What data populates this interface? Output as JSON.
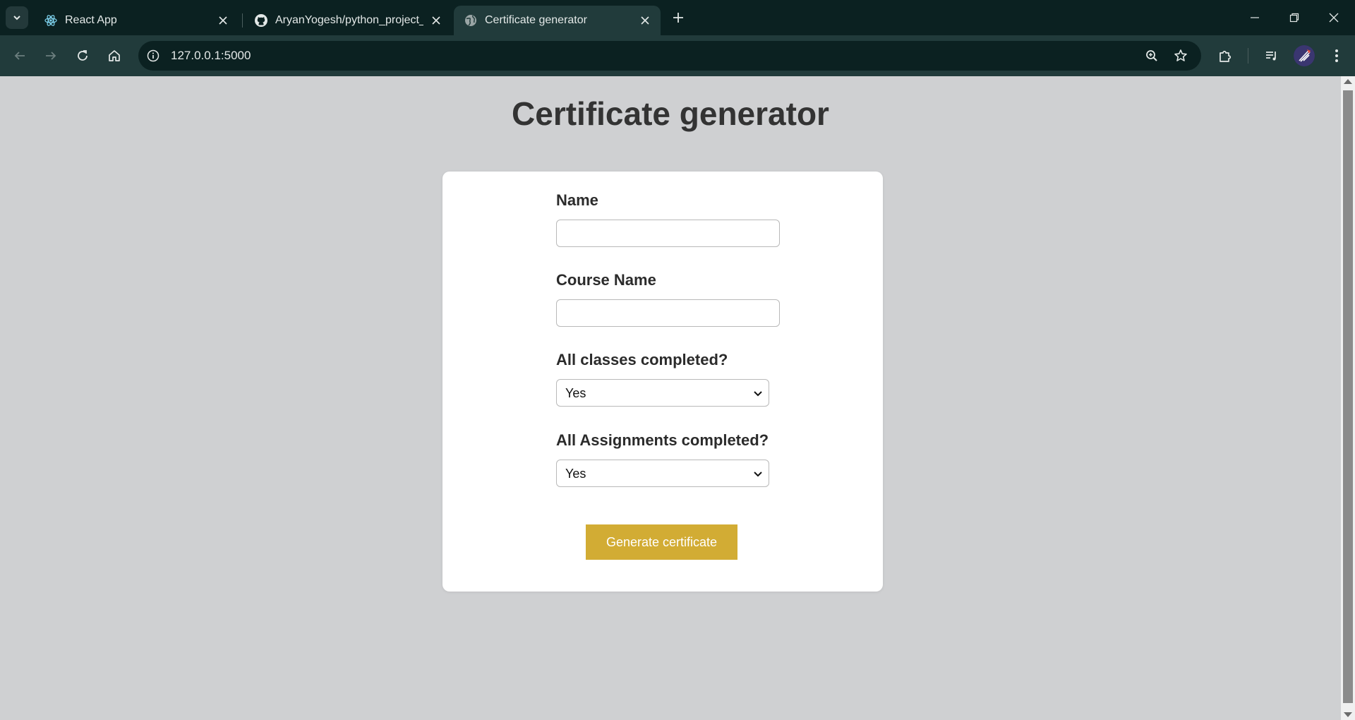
{
  "browser": {
    "tabs": [
      {
        "title": "React App",
        "favicon": "react-icon",
        "active": false
      },
      {
        "title": "AryanYogesh/python_project_ce",
        "favicon": "github-icon",
        "active": false
      },
      {
        "title": "Certificate generator",
        "favicon": "globe-icon",
        "active": true
      }
    ],
    "url": "127.0.0.1:5000"
  },
  "page": {
    "title": "Certificate generator",
    "form": {
      "name_label": "Name",
      "name_value": "",
      "course_label": "Course Name",
      "course_value": "",
      "classes_label": "All classes completed?",
      "classes_value": "Yes",
      "assignments_label": "All Assignments completed?",
      "assignments_value": "Yes",
      "submit_label": "Generate certificate"
    }
  },
  "colors": {
    "chrome_dark": "#0b2121",
    "chrome_toolbar": "#213b3b",
    "page_bg": "#cfd0d2",
    "button": "#d2ac34"
  }
}
